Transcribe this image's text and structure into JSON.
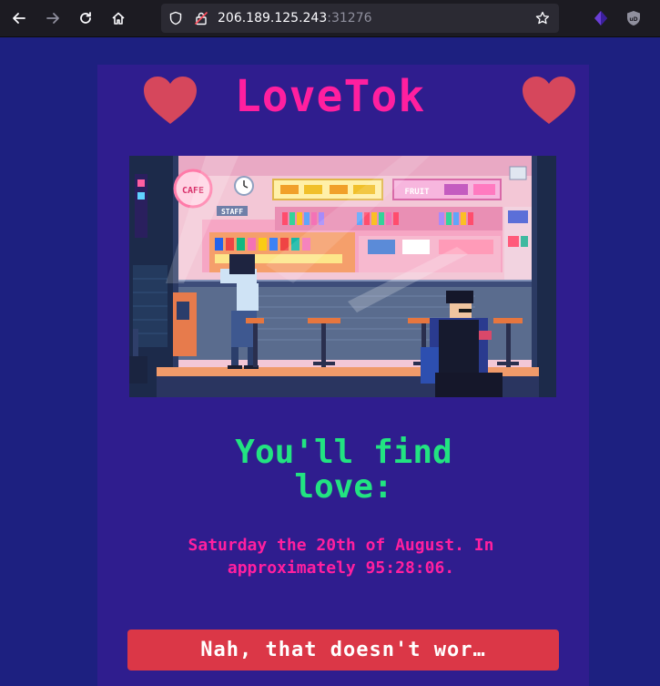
{
  "browser": {
    "url_host": "206.189.125.243",
    "url_port": ":31276",
    "icons": [
      "back-arrow-icon",
      "forward-arrow-icon",
      "reload-icon",
      "home-icon",
      "shield-icon",
      "insecure-lock-icon",
      "bookmark-star-icon",
      "extension-icon",
      "ublock-icon"
    ],
    "extension_badge": "uD"
  },
  "page": {
    "logo": "LoveTok",
    "headline_line1": "You'll find",
    "headline_line2": "love:",
    "when_line1": "Saturday the 20th of August. In",
    "when_line2": "approximately 95:28:06.",
    "button_label": "Nah, that doesn't wor…",
    "colors": {
      "background": "#1d2080",
      "panel": "#2f1d8e",
      "logo": "#ff1f9f",
      "headline": "#22e381",
      "button": "#db3747"
    }
  },
  "scene": {
    "shop_signs": [
      "CAFE",
      "STAFF",
      "FRUIT"
    ]
  }
}
